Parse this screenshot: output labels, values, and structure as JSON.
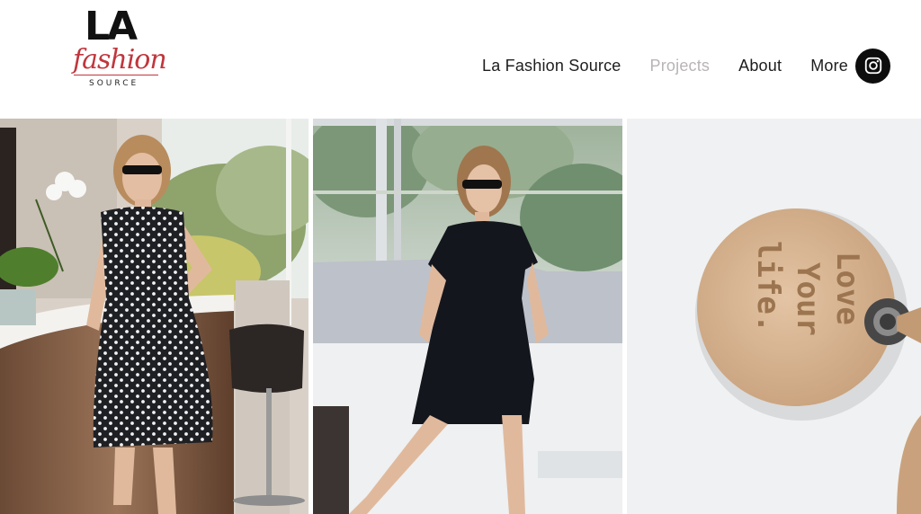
{
  "logo": {
    "line1": "LA",
    "line2": "fashion",
    "line3": "SOURCE"
  },
  "nav": {
    "items": [
      {
        "label": "La Fashion Source",
        "active": false
      },
      {
        "label": "Projects",
        "active": true
      },
      {
        "label": "About",
        "active": false
      },
      {
        "label": "More",
        "active": false
      }
    ],
    "social_icon": "instagram-icon"
  },
  "gallery": {
    "tiles": [
      {
        "name": "polka-dot-dress-photo",
        "subject": "woman in black polka dot dress"
      },
      {
        "name": "black-shift-dress-photo",
        "subject": "woman in black short-sleeve dress"
      },
      {
        "name": "leather-tag-photo",
        "text_lines": [
          "Love",
          "Your",
          "life."
        ]
      }
    ]
  },
  "colors": {
    "brand_red": "#c0363d",
    "nav_text": "#1d1d1d",
    "nav_active": "#b9b4b5"
  }
}
